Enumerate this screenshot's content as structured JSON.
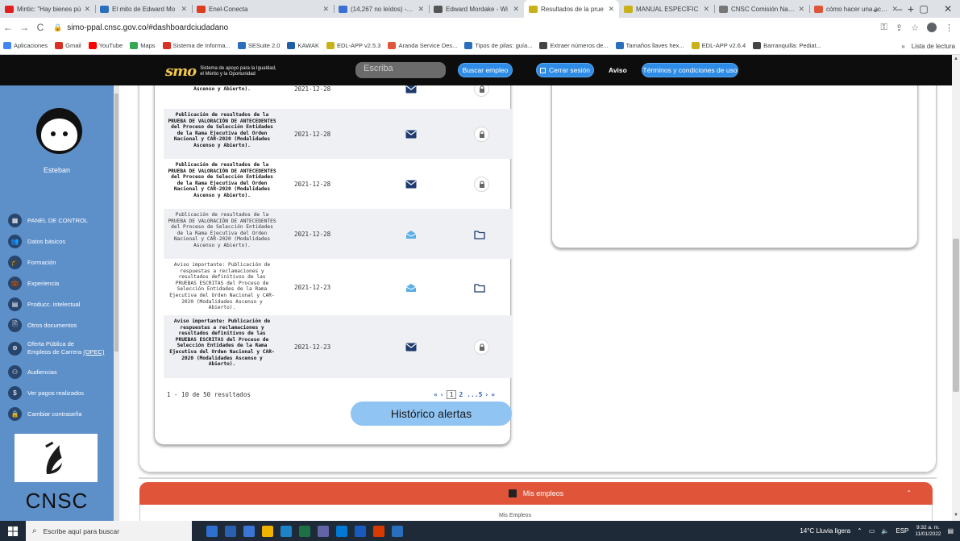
{
  "browser": {
    "tabs": [
      {
        "label": "Mintic: \"Hay bienes pú",
        "color": "#e02020",
        "active": false
      },
      {
        "label": "El mito de Edward Mo",
        "color": "#2a6fbd",
        "active": false
      },
      {
        "label": "Enel-Conecta",
        "color": "#e03c1e",
        "active": false
      },
      {
        "label": "(14,267 no leídos) - pe",
        "color": "#3b6fd1",
        "active": false
      },
      {
        "label": "Edward Mordake - Wi",
        "color": "#555555",
        "active": false
      },
      {
        "label": "Resultados de la prue",
        "color": "#c9b11a",
        "active": true
      },
      {
        "label": "MANUAL ESPECÍFIC",
        "color": "#c9b11a",
        "active": false
      },
      {
        "label": "CNSC Comisión Nacio",
        "color": "#777777",
        "active": false
      },
      {
        "label": "cómo hacer una acció",
        "color": "#e0553a",
        "active": false
      }
    ],
    "new_tab": "+",
    "window_controls": [
      "⌄",
      "–",
      "▢",
      "✕"
    ],
    "url": "simo-ppal.cnsc.gov.co/#dashboardciudadano",
    "bookmarks": [
      {
        "label": "Aplicaciones",
        "color": "#4285f4"
      },
      {
        "label": "Gmail",
        "color": "#d93025"
      },
      {
        "label": "YouTube",
        "color": "#ff0000"
      },
      {
        "label": "Maps",
        "color": "#34a853"
      },
      {
        "label": "Sistema de Informa...",
        "color": "#d93025"
      },
      {
        "label": "SESuite 2.0",
        "color": "#2a6fbd"
      },
      {
        "label": "KAWAK",
        "color": "#1f5fa8"
      },
      {
        "label": "EDL-APP v2.5.3",
        "color": "#c9b11a"
      },
      {
        "label": "Aranda Service Des...",
        "color": "#e0553a"
      },
      {
        "label": "Tipos de pilas: guía...",
        "color": "#2a6fbd"
      },
      {
        "label": "Extraer números de...",
        "color": "#444444"
      },
      {
        "label": "Tamaños llaves hex...",
        "color": "#2a6fbd"
      },
      {
        "label": "EDL-APP v2.6.4",
        "color": "#c9b11a"
      },
      {
        "label": "Barranquilla: Pediat...",
        "color": "#444444"
      }
    ],
    "bookmarks_more": "»",
    "reading_list": "Lista de lectura"
  },
  "header": {
    "logo_mark": "smo",
    "logo_tagline_1": "Sistema de apoyo para la Igualdad,",
    "logo_tagline_2": "el Mérito y la Oportunidad",
    "search_placeholder": "Escriba",
    "search_button": "Buscar empleo",
    "logout_button": "Cerrar sesión",
    "notice": "Aviso",
    "terms_button": "Términos y condiciones de uso"
  },
  "sidebar": {
    "username": "Esteban",
    "items": [
      {
        "label": "PANEL DE CONTROL",
        "icon": "▦"
      },
      {
        "label": "Datos básicos",
        "icon": "👥"
      },
      {
        "label": "Formación",
        "icon": "🎓"
      },
      {
        "label": "Experiencia",
        "icon": "💼"
      },
      {
        "label": "Producc. intelectual",
        "icon": "▤"
      },
      {
        "label": "Otros documentos",
        "icon": "🗎"
      },
      {
        "label": "Oferta Pública de",
        "label2": "Empleos de Carrera (OPEC)",
        "icon": "⊛"
      },
      {
        "label": "Audiencias",
        "icon": "⚇"
      },
      {
        "label": "Ver pagos realizados",
        "icon": "$"
      },
      {
        "label": "Cambiar contraseña",
        "icon": "🔒"
      }
    ],
    "org_name": "CNSC"
  },
  "alerts": {
    "rows": [
      {
        "text": "Publicación de resultados de la PRUEBA DE VALORACIÓN DE ANTECEDENTES del Proceso de Selección Entidades de la Rama Ejecutiva del Orden Nacional y CAR-2020 (Modalidades Ascenso y Abierto).",
        "date": "2021-12-28",
        "read": false
      },
      {
        "text": "Publicación de resultados de la PRUEBA DE VALORACIÓN DE ANTECEDENTES del Proceso de Selección Entidades de la Rama Ejecutiva del Orden Nacional y CAR-2020 (Modalidades Ascenso y Abierto).",
        "date": "2021-12-28",
        "read": false
      },
      {
        "text": "Publicación de resultados de la PRUEBA DE VALORACIÓN DE ANTECEDENTES del Proceso de Selección Entidades de la Rama Ejecutiva del Orden Nacional y CAR-2020 (Modalidades Ascenso y Abierto).",
        "date": "2021-12-28",
        "read": false
      },
      {
        "text": "Publicación de resultados de la PRUEBA DE VALORACIÓN DE ANTECEDENTES del Proceso de Selección Entidades de la Rama Ejecutiva del Orden Nacional y CAR-2020 (Modalidades Ascenso y Abierto).",
        "date": "2021-12-28",
        "read": true
      },
      {
        "text": "Aviso importante: Publicación de respuestas a reclamaciones y resultados definitivos de las PRUEBAS ESCRITAS del Proceso de Selección Entidades de la Rama Ejecutiva del Orden Nacional y CAR-2020 (Modalidades Ascenso y Abierto).",
        "date": "2021-12-23",
        "read": true
      },
      {
        "text": "Aviso importante: Publicación de respuestas a reclamaciones y resultados definitivos de las PRUEBAS ESCRITAS del Proceso de Selección Entidades de la Rama Ejecutiva del Orden Nacional y CAR-2020 (Modalidades Ascenso y Abierto).",
        "date": "2021-12-23",
        "read": false
      }
    ],
    "results_text": "1 - 10 de 50 resultados",
    "pager": {
      "first": "«",
      "prev": "‹",
      "current": "1",
      "next_pages": "2 ...5",
      "next": "›",
      "last": "»"
    },
    "history_button": "Histórico alertas"
  },
  "jobs_panel": {
    "title": "Mis empleos",
    "collapse_icon": "⌃",
    "hint": "Mis Empleos"
  },
  "taskbar": {
    "search_placeholder": "Escribe aquí para buscar",
    "weather": "14°C  Lluvia ligera",
    "lang": "ESP",
    "time": "9:32 a. m.",
    "date": "11/01/2022",
    "apps": [
      "#2e6fcf",
      "#2b5fb0",
      "#3b76d6",
      "#f0b400",
      "#1c84c6",
      "#1e7145",
      "#6264a7",
      "#0078d4",
      "#185abd",
      "#d83b01",
      "#2a6fbd"
    ]
  }
}
